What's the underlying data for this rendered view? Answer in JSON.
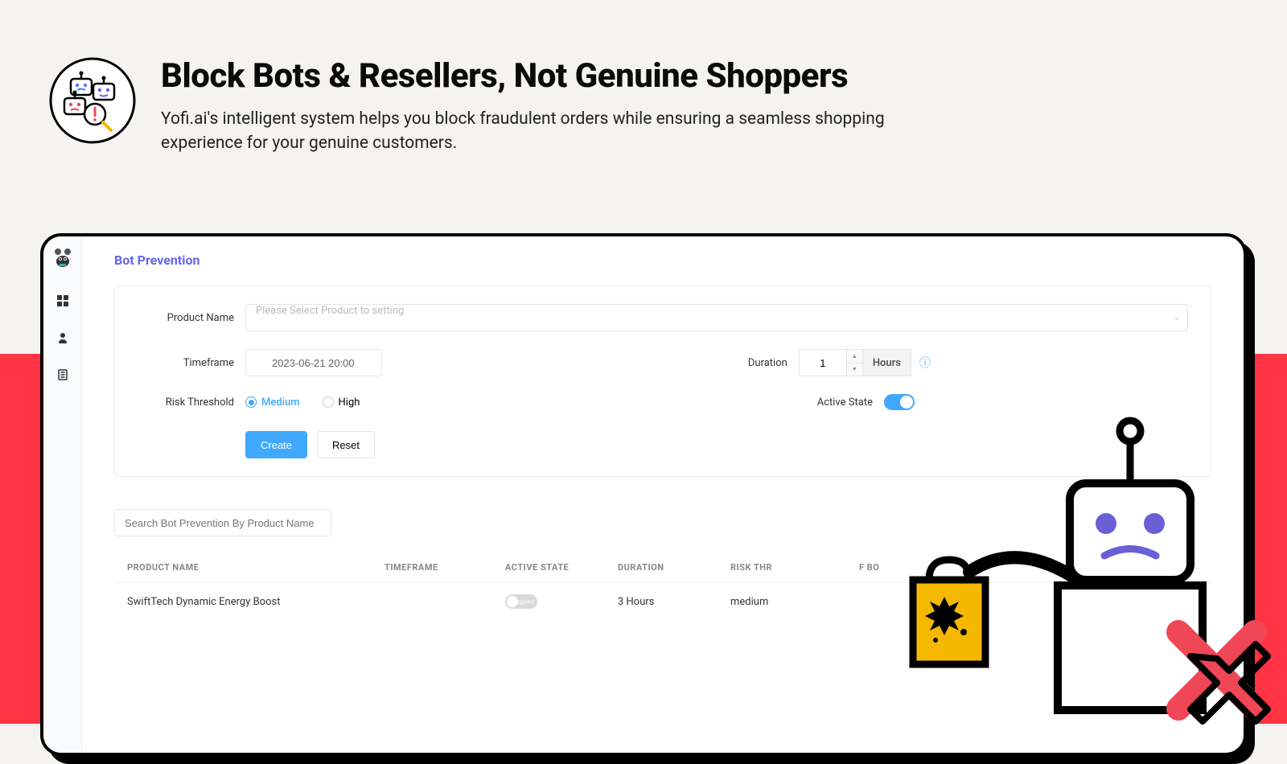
{
  "hero": {
    "title": "Block Bots & Resellers, Not Genuine Shoppers",
    "subtitle": "Yofi.ai's intelligent system helps you block fraudulent orders while ensuring a seamless shopping experience for your genuine customers."
  },
  "page": {
    "title": "Bot Prevention"
  },
  "form": {
    "product_label": "Product Name",
    "product_placeholder": "Please Select Product to setting",
    "timeframe_label": "Timeframe",
    "timeframe_value": "2023-06-21 20:00",
    "duration_label": "Duration",
    "duration_value": "1",
    "duration_unit": "Hours",
    "risk_label": "Risk Threshold",
    "risk_options": {
      "medium": "Medium",
      "high": "High"
    },
    "risk_selected": "medium",
    "active_label": "Active State",
    "create_btn": "Create",
    "reset_btn": "Reset"
  },
  "search": {
    "placeholder": "Search Bot Prevention By Product Name"
  },
  "table": {
    "headers": {
      "name": "PRODUCT NAME",
      "timeframe": "TIMEFRAME",
      "active": "ACTIVE STATE",
      "duration": "DURATION",
      "risk": "RISK THR",
      "bots": "F BO"
    },
    "rows": [
      {
        "name": "SwiftTech Dynamic Energy Boost",
        "timeframe": "",
        "active": "expired",
        "duration": "3 Hours",
        "risk": "medium"
      }
    ]
  }
}
